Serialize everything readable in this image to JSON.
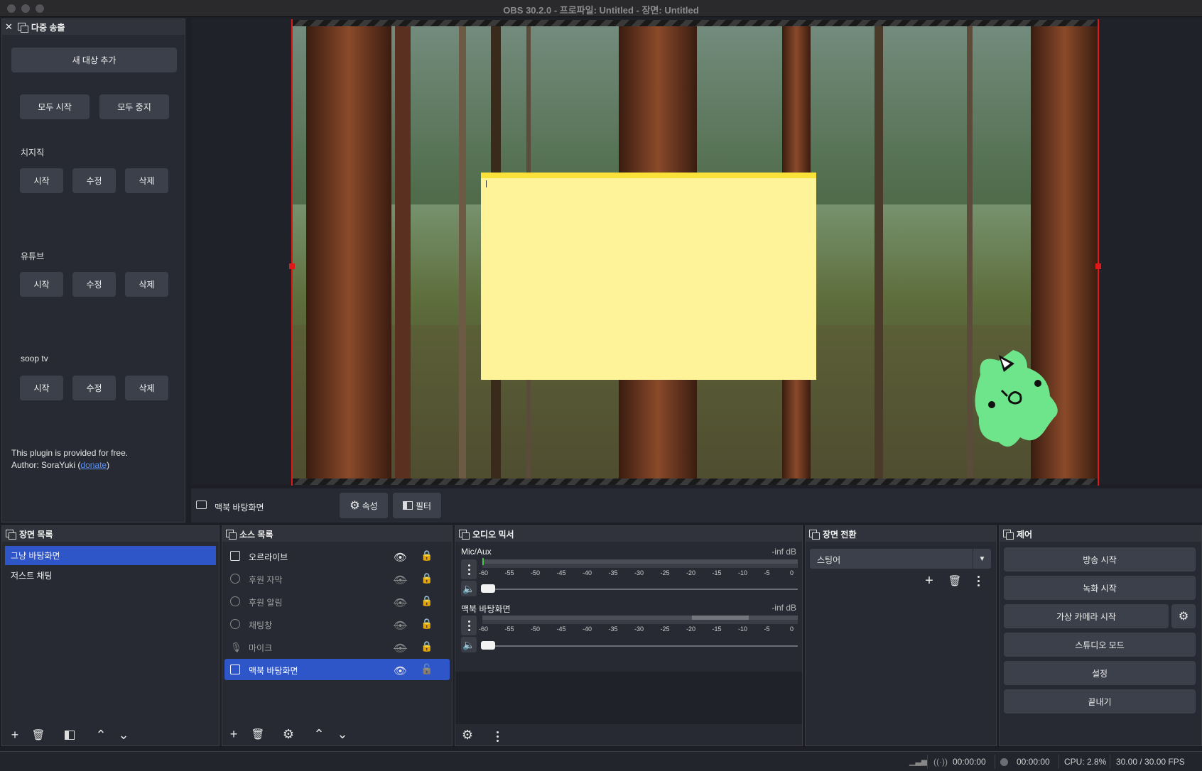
{
  "window": {
    "title": "OBS 30.2.0 - 프로파일: Untitled - 장면: Untitled"
  },
  "multistream": {
    "title": "다중 송출",
    "add_target": "새 대상 추가",
    "start_all": "모두 시작",
    "stop_all": "모두 중지",
    "targets": [
      {
        "name": "치지직",
        "start": "시작",
        "edit": "수정",
        "delete": "삭제"
      },
      {
        "name": "유튜브",
        "start": "시작",
        "edit": "수정",
        "delete": "삭제"
      },
      {
        "name": "soop tv",
        "start": "시작",
        "edit": "수정",
        "delete": "삭제"
      }
    ],
    "plugin_note": "This plugin is provided for free.",
    "author_prefix": "Author: SoraYuki (",
    "author_link": "donate",
    "author_suffix": ")"
  },
  "source_toolbar": {
    "selected_source": "맥북 바탕화면",
    "properties": "속성",
    "filters": "필터"
  },
  "scenes": {
    "title": "장면 목록",
    "items": [
      {
        "label": "그냥 바탕화면",
        "selected": true
      },
      {
        "label": "저스트 채팅",
        "selected": false
      }
    ]
  },
  "sources": {
    "title": "소스 목록",
    "items": [
      {
        "label": "오르라이브",
        "icon": "image-icon",
        "visible": true,
        "locked": true
      },
      {
        "label": "후원 자막",
        "icon": "browser-icon",
        "visible": false,
        "locked": true
      },
      {
        "label": "후원 알림",
        "icon": "browser-icon",
        "visible": false,
        "locked": true
      },
      {
        "label": "채팅창",
        "icon": "browser-icon",
        "visible": false,
        "locked": true
      },
      {
        "label": "마이크",
        "icon": "mic-icon",
        "visible": false,
        "locked": true
      },
      {
        "label": "맥북 바탕화면",
        "icon": "display-icon",
        "visible": true,
        "locked": false,
        "selected": true
      }
    ]
  },
  "mixer": {
    "title": "오디오 믹서",
    "channels": [
      {
        "name": "Mic/Aux",
        "level": "-inf dB"
      },
      {
        "name": "맥북 바탕화면",
        "level": "-inf dB"
      }
    ],
    "scale": [
      "-60",
      "-55",
      "-50",
      "-45",
      "-40",
      "-35",
      "-30",
      "-25",
      "-20",
      "-15",
      "-10",
      "-5",
      "0"
    ]
  },
  "transitions": {
    "title": "장면 전환",
    "selected": "스팅어"
  },
  "controls": {
    "title": "제어",
    "start_streaming": "방송 시작",
    "start_recording": "녹화 시작",
    "start_virtual_cam": "가상 카메라 시작",
    "studio_mode": "스튜디오 모드",
    "settings": "설정",
    "exit": "끝내기"
  },
  "status": {
    "stream_time": "00:00:00",
    "record_time": "00:00:00",
    "cpu": "CPU: 2.8%",
    "fps": "30.00 / 30.00 FPS"
  },
  "colors": {
    "accent": "#2f56c8",
    "bounding_box": "#e01818",
    "note": "#fef398",
    "mascot": "#6ee58a"
  }
}
